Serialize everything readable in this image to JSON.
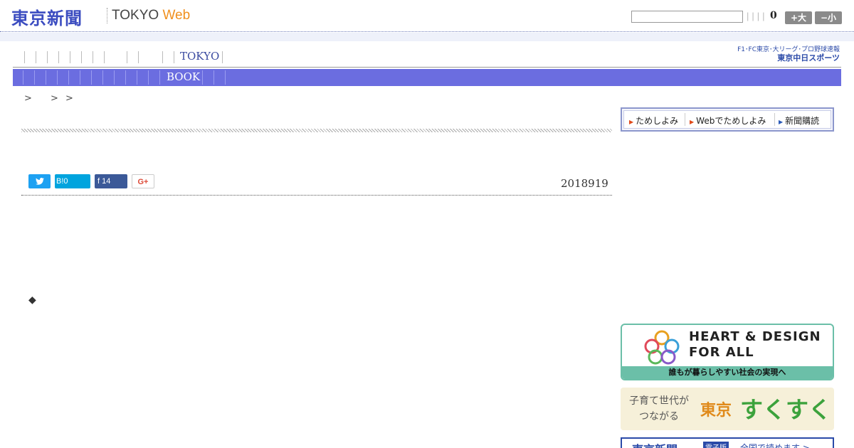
{
  "header": {
    "logo_jp": "東京新聞",
    "logo_en_prefix": "TOKYO ",
    "logo_en_web": "Web",
    "mini_links": "||||",
    "count": "0",
    "btn_large": "+大",
    "btn_small": "−小"
  },
  "nav": {
    "tokyo_label": "TOKYO",
    "book_label": "BOOK"
  },
  "sports_link": {
    "line1": "F1･FC東京･大リーグ･プロ野球速報",
    "line2": "東京中日スポーツ"
  },
  "breadcrumb": ">　 > >",
  "share": {
    "twitter": "🐦",
    "hatena": "B!0",
    "facebook": "f  14",
    "googleplus": "G+"
  },
  "article": {
    "date": "2018919",
    "bullet": "◆"
  },
  "subscribe": {
    "item1": "ためしよみ",
    "item2": "Webでためしよみ",
    "item3": "新聞購読"
  },
  "ads": {
    "heart_line1": "HEART & DESIGN",
    "heart_line2": "FOR ALL",
    "heart_foot": "誰もが暮らしやすい社会の実現へ",
    "sukusuku_line1": "子育て世代が",
    "sukusuku_line2": "つながる",
    "sukusuku_tokyo": "東京",
    "sukusuku_brand": "すくすく",
    "denshi_name": "東京新聞",
    "denshi_tag": "電子版",
    "denshi_text": "全国で読めます >"
  }
}
